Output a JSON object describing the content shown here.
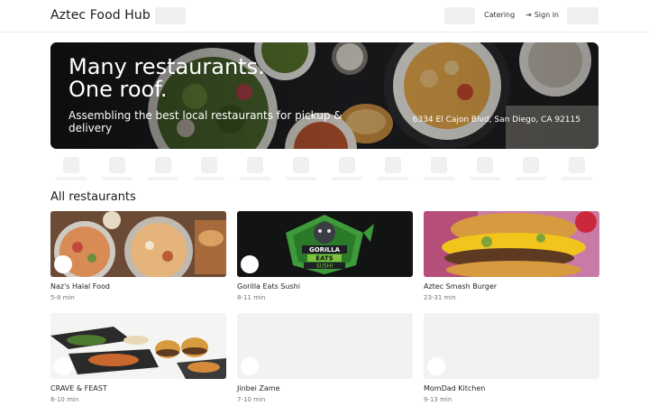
{
  "header": {
    "brand": "Aztec Food Hub",
    "catering": "Catering",
    "signin": "Sign in",
    "signin_icon": "sign-in-icon"
  },
  "hero": {
    "title": "Many restaurants.\nOne roof.",
    "subtitle": "Assembling the best local restaurants for pickup & delivery",
    "address": "6334 El Cajon Blvd, San Diego, CA 92115"
  },
  "section": {
    "title": "All restaurants"
  },
  "restaurants": [
    {
      "name": "Naz's Halal Food",
      "eta": "5-8 min"
    },
    {
      "name": "Gorilla Eats Sushi",
      "eta": "8-11 min"
    },
    {
      "name": "Aztec Smash Burger",
      "eta": "23-31 min"
    },
    {
      "name": "CRAVE & FEAST",
      "eta": "8-10 min"
    },
    {
      "name": "Jinbei Zame",
      "eta": "7-10 min"
    },
    {
      "name": "MomDad Kitchen",
      "eta": "9-13 min"
    }
  ],
  "logo_art": {
    "line1": "GORILLA",
    "line2": "EATS",
    "line3": "SUSHI"
  }
}
